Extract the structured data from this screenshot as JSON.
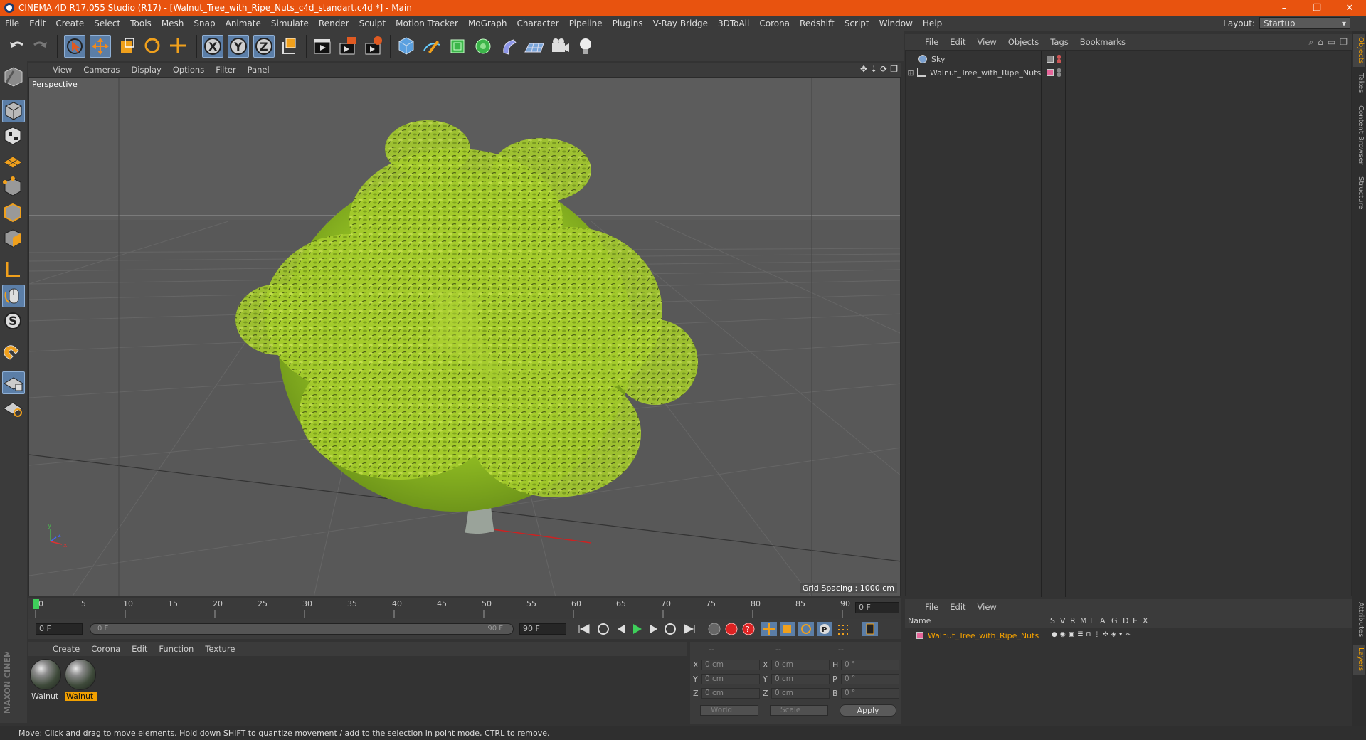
{
  "window": {
    "title": "CINEMA 4D R17.055 Studio (R17) - [Walnut_Tree_with_Ripe_Nuts_c4d_standart.c4d *] - Main",
    "minimize": "–",
    "restore": "❐",
    "close": "✕"
  },
  "menubar": {
    "items": [
      "File",
      "Edit",
      "Create",
      "Select",
      "Tools",
      "Mesh",
      "Snap",
      "Animate",
      "Simulate",
      "Render",
      "Sculpt",
      "Motion Tracker",
      "MoGraph",
      "Character",
      "Pipeline",
      "Plugins",
      "V-Ray Bridge",
      "3DToAll",
      "Corona",
      "Redshift",
      "Script",
      "Window",
      "Help"
    ],
    "layout_label": "Layout:",
    "layout_value": "Startup"
  },
  "viewport": {
    "menu": [
      "View",
      "Cameras",
      "Display",
      "Options",
      "Filter",
      "Panel"
    ],
    "label": "Perspective",
    "grid_spacing": "Grid Spacing : 1000 cm",
    "axis_x": "x",
    "axis_y": "y",
    "axis_z": "z"
  },
  "timeline": {
    "ticks": [
      "0",
      "5",
      "10",
      "15",
      "20",
      "25",
      "30",
      "35",
      "40",
      "45",
      "50",
      "55",
      "60",
      "65",
      "70",
      "75",
      "80",
      "85",
      "90"
    ],
    "current_frame": "0 F",
    "start_field": "0 F",
    "range_start": "0 F",
    "range_end": "90 F",
    "end_field": "90 F"
  },
  "materials": {
    "menu": [
      "Create",
      "Corona",
      "Edit",
      "Function",
      "Texture"
    ],
    "items": [
      {
        "label": "Walnut",
        "selected": false
      },
      {
        "label": "Walnut",
        "selected": true
      }
    ]
  },
  "coordinates": {
    "header": [
      "--",
      "--",
      "--"
    ],
    "rows": [
      {
        "a": "X",
        "av": "0 cm",
        "b": "X",
        "bv": "0 cm",
        "c": "H",
        "cv": "0 °"
      },
      {
        "a": "Y",
        "av": "0 cm",
        "b": "Y",
        "bv": "0 cm",
        "c": "P",
        "cv": "0 °"
      },
      {
        "a": "Z",
        "av": "0 cm",
        "b": "Z",
        "bv": "0 cm",
        "c": "B",
        "cv": "0 °"
      }
    ],
    "mode": "World",
    "scale": "Scale",
    "apply": "Apply"
  },
  "objects": {
    "menu": [
      "File",
      "Edit",
      "View",
      "Objects",
      "Tags",
      "Bookmarks"
    ],
    "items": [
      {
        "name": "Sky",
        "color": "#9a9a9a"
      },
      {
        "name": "Walnut_Tree_with_Ripe_Nuts",
        "color": "#e6669a"
      }
    ]
  },
  "layers": {
    "menu": [
      "File",
      "Edit",
      "View"
    ],
    "columns": [
      "Name",
      "S",
      "V",
      "R",
      "M",
      "L",
      "A",
      "G",
      "D",
      "E",
      "X"
    ],
    "items": [
      {
        "name": "Walnut_Tree_with_Ripe_Nuts",
        "color": "#e6669a"
      }
    ]
  },
  "sidetabs": {
    "top": [
      "Objects",
      "Takes",
      "Content Browser",
      "Structure"
    ],
    "bottom": [
      "Attributes",
      "Layers"
    ]
  },
  "status": "Move: Click and drag to move elements. Hold down SHIFT to quantize movement / add to the selection in point mode, CTRL to remove.",
  "brand": "MAXON CINEMA 4D",
  "colors": {
    "titlebar": "#e8530f",
    "accent": "#f2a000",
    "selected_tool": "#5b7ea7",
    "foliage": "#9cc62a"
  }
}
